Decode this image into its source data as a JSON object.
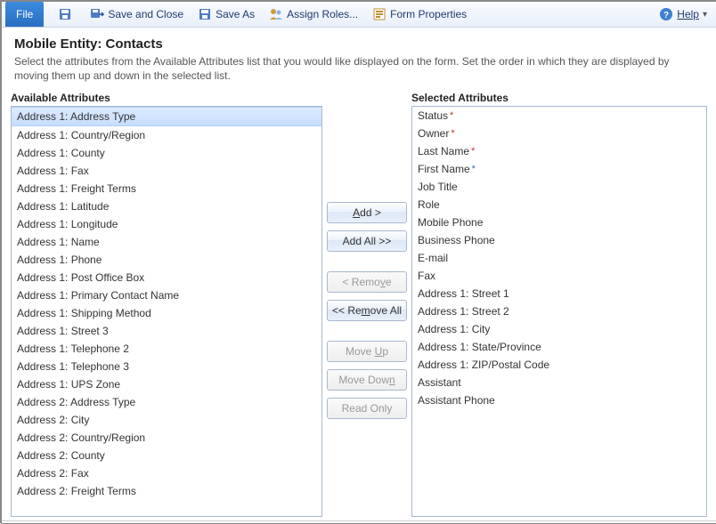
{
  "toolbar": {
    "file": "File",
    "save": "",
    "save_close": "Save and Close",
    "save_as": "Save As",
    "assign_roles": "Assign Roles...",
    "form_props": "Form Properties",
    "help": "Help"
  },
  "header": {
    "title": "Mobile Entity: Contacts",
    "desc": "Select the attributes from the Available Attributes list that you would like displayed on the form. Set the order in which they are displayed by moving them up and down in the selected list."
  },
  "available": {
    "title": "Available Attributes",
    "items": [
      "Address 1: Address Type",
      "Address 1: Country/Region",
      "Address 1: County",
      "Address 1: Fax",
      "Address 1: Freight Terms",
      "Address 1: Latitude",
      "Address 1: Longitude",
      "Address 1: Name",
      "Address 1: Phone",
      "Address 1: Post Office Box",
      "Address 1: Primary Contact Name",
      "Address 1: Shipping Method",
      "Address 1: Street 3",
      "Address 1: Telephone 2",
      "Address 1: Telephone 3",
      "Address 1: UPS Zone",
      "Address 2: Address Type",
      "Address 2: City",
      "Address 2: Country/Region",
      "Address 2: County",
      "Address 2: Fax",
      "Address 2: Freight Terms"
    ],
    "selected_index": 0
  },
  "selected": {
    "title": "Selected Attributes",
    "items": [
      {
        "label": "Status",
        "req": "red"
      },
      {
        "label": "Owner",
        "req": "red"
      },
      {
        "label": "Last Name",
        "req": "red"
      },
      {
        "label": "First Name",
        "req": "blue"
      },
      {
        "label": "Job Title",
        "req": null
      },
      {
        "label": "Role",
        "req": null
      },
      {
        "label": "Mobile Phone",
        "req": null
      },
      {
        "label": "Business Phone",
        "req": null
      },
      {
        "label": "E-mail",
        "req": null
      },
      {
        "label": "Fax",
        "req": null
      },
      {
        "label": "Address 1: Street 1",
        "req": null
      },
      {
        "label": "Address 1: Street 2",
        "req": null
      },
      {
        "label": "Address 1: City",
        "req": null
      },
      {
        "label": "Address 1: State/Province",
        "req": null
      },
      {
        "label": "Address 1: ZIP/Postal Code",
        "req": null
      },
      {
        "label": "Assistant",
        "req": null
      },
      {
        "label": "Assistant Phone",
        "req": null
      }
    ]
  },
  "buttons": {
    "add": "Add >",
    "add_all": "Add All >>",
    "remove": "< Remove",
    "remove_all": "<< Remove All",
    "move_up": "Move Up",
    "move_down": "Move Down",
    "read_only": "Read Only"
  }
}
